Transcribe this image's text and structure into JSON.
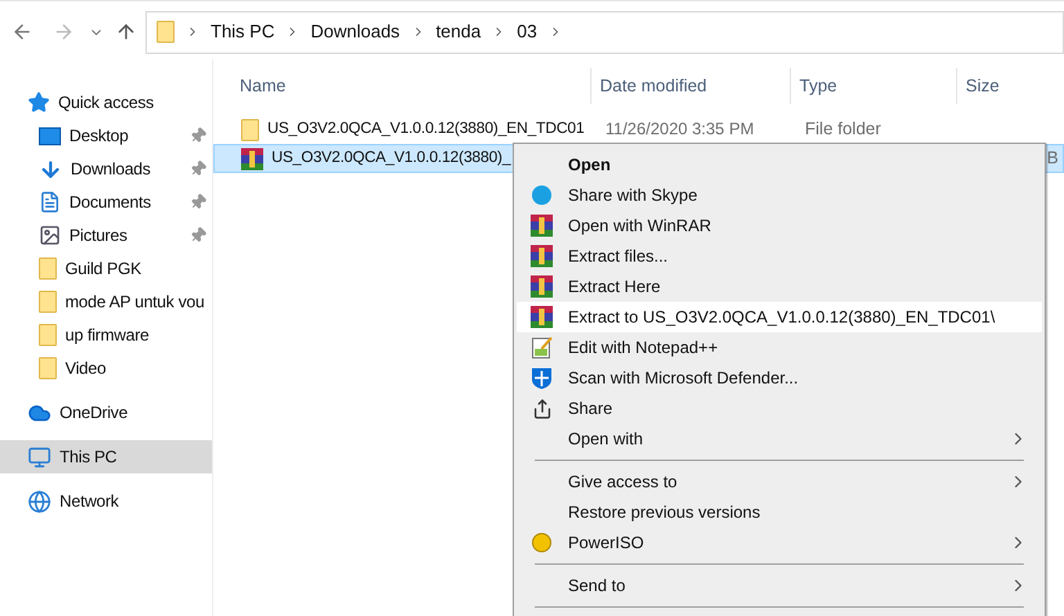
{
  "address_bar": {
    "crumbs": [
      "This PC",
      "Downloads",
      "tenda",
      "03"
    ]
  },
  "sidebar": {
    "items": [
      {
        "label": "Quick access",
        "selected": false,
        "children": [
          {
            "label": "Desktop",
            "pinned": true,
            "selected": false
          },
          {
            "label": "Downloads",
            "pinned": true,
            "selected": false
          },
          {
            "label": "Documents",
            "pinned": true,
            "selected": false
          },
          {
            "label": "Pictures",
            "pinned": true,
            "selected": false
          },
          {
            "label": "Guild PGK",
            "pinned": false,
            "selected": false
          },
          {
            "label": "mode AP untuk vou",
            "pinned": false,
            "selected": false
          },
          {
            "label": "up firmware",
            "pinned": false,
            "selected": false
          },
          {
            "label": "Video",
            "pinned": false,
            "selected": false
          }
        ]
      },
      {
        "label": "OneDrive",
        "selected": false
      },
      {
        "label": "This PC",
        "selected": true
      },
      {
        "label": "Network",
        "selected": false
      }
    ]
  },
  "file_list": {
    "columns": [
      "Name",
      "Date modified",
      "Type",
      "Size"
    ],
    "rows": [
      {
        "kind": "folder",
        "name": "US_O3V2.0QCA_V1.0.0.12(3880)_EN_TDC01",
        "date": "11/26/2020 3:35 PM",
        "type": "File folder",
        "size": "",
        "selected": false
      },
      {
        "kind": "archive",
        "name": "US_O3V2.0QCA_V1.0.0.12(3880)_",
        "date": "",
        "type": "",
        "size": "B",
        "selected": true
      }
    ]
  },
  "context_menu": {
    "items": [
      {
        "kind": "item",
        "label": "Open",
        "default": true,
        "submenu": false,
        "highlighted": false
      },
      {
        "kind": "item",
        "label": "Share with Skype",
        "default": false,
        "submenu": false,
        "highlighted": false
      },
      {
        "kind": "item",
        "label": "Open with WinRAR",
        "default": false,
        "submenu": false,
        "highlighted": false
      },
      {
        "kind": "item",
        "label": "Extract files...",
        "default": false,
        "submenu": false,
        "highlighted": false
      },
      {
        "kind": "item",
        "label": "Extract Here",
        "default": false,
        "submenu": false,
        "highlighted": false
      },
      {
        "kind": "item",
        "label": "Extract to US_O3V2.0QCA_V1.0.0.12(3880)_EN_TDC01\\",
        "default": false,
        "submenu": false,
        "highlighted": true
      },
      {
        "kind": "item",
        "label": "Edit with Notepad++",
        "default": false,
        "submenu": false,
        "highlighted": false
      },
      {
        "kind": "item",
        "label": "Scan with Microsoft Defender...",
        "default": false,
        "submenu": false,
        "highlighted": false
      },
      {
        "kind": "item",
        "label": "Share",
        "default": false,
        "submenu": false,
        "highlighted": false
      },
      {
        "kind": "item",
        "label": "Open with",
        "default": false,
        "submenu": true,
        "highlighted": false
      },
      {
        "kind": "separator"
      },
      {
        "kind": "item",
        "label": "Give access to",
        "default": false,
        "submenu": true,
        "highlighted": false
      },
      {
        "kind": "item",
        "label": "Restore previous versions",
        "default": false,
        "submenu": false,
        "highlighted": false
      },
      {
        "kind": "item",
        "label": "PowerISO",
        "default": false,
        "submenu": true,
        "highlighted": false
      },
      {
        "kind": "separator"
      },
      {
        "kind": "item",
        "label": "Send to",
        "default": false,
        "submenu": true,
        "highlighted": false
      },
      {
        "kind": "separator"
      }
    ]
  }
}
